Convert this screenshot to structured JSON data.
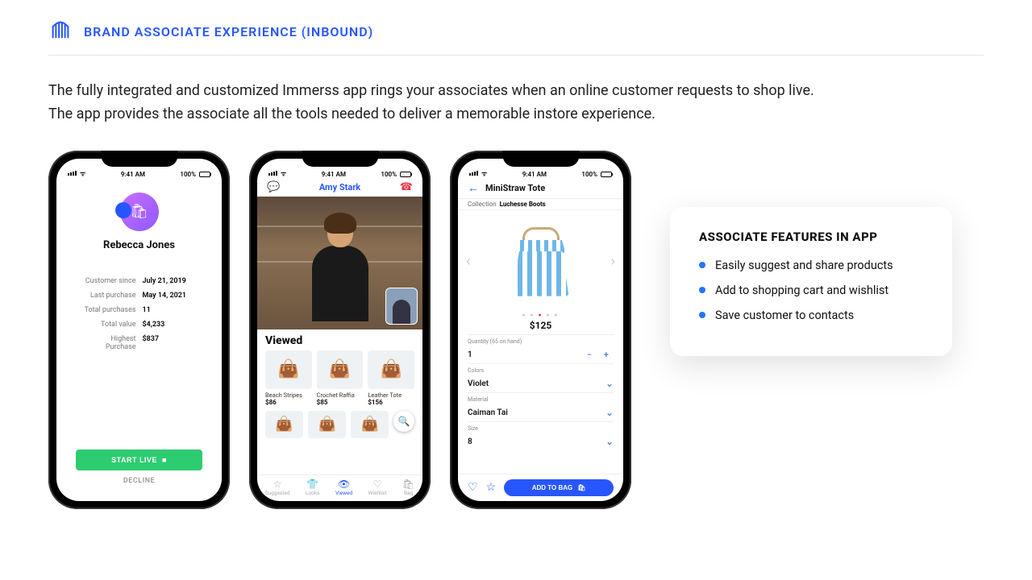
{
  "header": {
    "title": "BRAND ASSOCIATE EXPERIENCE (INBOUND)"
  },
  "intro": {
    "line1": "The fully integrated and customized Immerss app rings your associates when an online customer requests to shop live.",
    "line2": "The app provides the associate all the tools needed to deliver a memorable instore experience."
  },
  "status": {
    "time": "9:41 AM",
    "battery": "100%"
  },
  "phone1": {
    "name": "Rebecca Jones",
    "rows": [
      {
        "label": "Customer since",
        "value": "July 21, 2019"
      },
      {
        "label": "Last purchase",
        "value": "May 14, 2021"
      },
      {
        "label": "Total purchases",
        "value": "11"
      },
      {
        "label": "Total value",
        "value": "$4,233"
      },
      {
        "label": "Highest Purchase",
        "value": "$837"
      }
    ],
    "start": "START LIVE",
    "decline": "DECLINE"
  },
  "phone2": {
    "name": "Amy Stark",
    "section": "Viewed",
    "products": [
      {
        "name": "Beach Stripes",
        "price": "$86"
      },
      {
        "name": "Crochet Raffia",
        "price": "$85"
      },
      {
        "name": "Leather Tote",
        "price": "$156"
      }
    ],
    "tabs": [
      {
        "icon": "☆",
        "label": "Suggested"
      },
      {
        "icon": "👕",
        "label": "Looks"
      },
      {
        "icon": "👁",
        "label": "Viewed"
      },
      {
        "icon": "♡",
        "label": "Wishlist"
      },
      {
        "icon": "🛍",
        "label": "Bag"
      }
    ]
  },
  "phone3": {
    "title": "MiniStraw Tote",
    "collection_label": "Collection",
    "collection": "Luchesse Boots",
    "price": "$125",
    "qty_label": "Quantity (65 on hand)",
    "qty": "1",
    "options": [
      {
        "label": "Colors",
        "value": "Violet"
      },
      {
        "label": "Material",
        "value": "Caiman Tai"
      },
      {
        "label": "Size",
        "value": "8"
      }
    ],
    "add": "ADD TO BAG"
  },
  "card": {
    "title": "ASSOCIATE FEATURES IN APP",
    "items": [
      "Easily suggest and share products",
      "Add to shopping cart and wishlist",
      "Save customer to contacts"
    ]
  }
}
